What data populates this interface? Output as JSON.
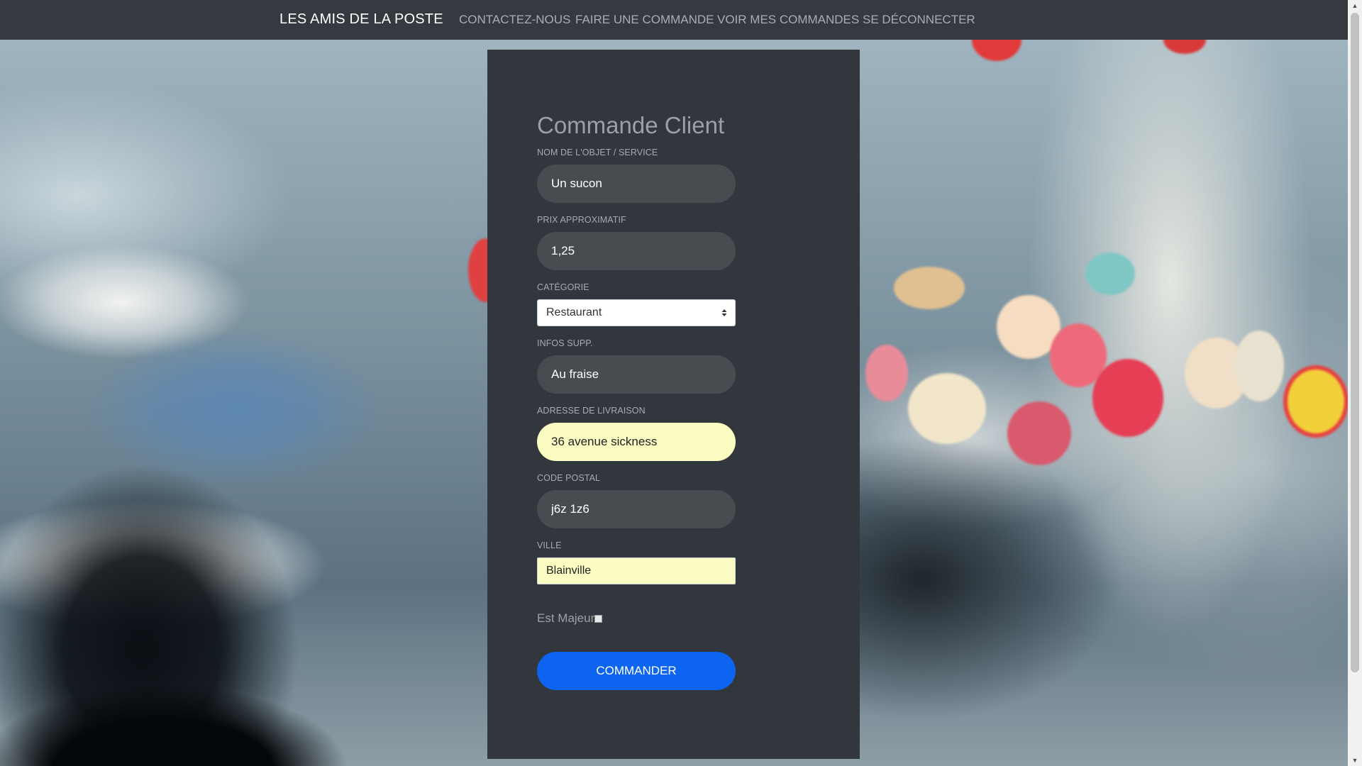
{
  "navbar": {
    "brand": "LES AMIS DE LA POSTE",
    "links": [
      "CONTACTEZ-NOUS",
      "FAIRE UNE COMMANDE",
      "VOIR MES COMMANDES",
      "SE DÉCONNECTER"
    ]
  },
  "form": {
    "title": "Commande Client",
    "fields": [
      {
        "label": "NOM DE L'OBJET / SERVICE",
        "value": "Un sucon"
      },
      {
        "label": "PRIX APPROXIMATIF",
        "value": "1,25"
      },
      {
        "label": "CATÉGORIE",
        "value": "Restaurant"
      },
      {
        "label": "INFOS SUPP.",
        "value": "Au fraise"
      },
      {
        "label": "ADRESSE DE LIVRAISON",
        "value": "36 avenue sickness"
      },
      {
        "label": "CODE POSTAL",
        "value": "j6z 1z6"
      },
      {
        "label": "VILLE",
        "value": "Blainville"
      }
    ],
    "checkbox_label": "Est Majeur",
    "checkbox_checked": false,
    "submit_label": "COMMANDER"
  },
  "colors": {
    "navbar": "#343a40",
    "panel": "#32373d",
    "input": "#484c51",
    "autofill": "#fbfcc2",
    "button": "#0d64f0"
  }
}
